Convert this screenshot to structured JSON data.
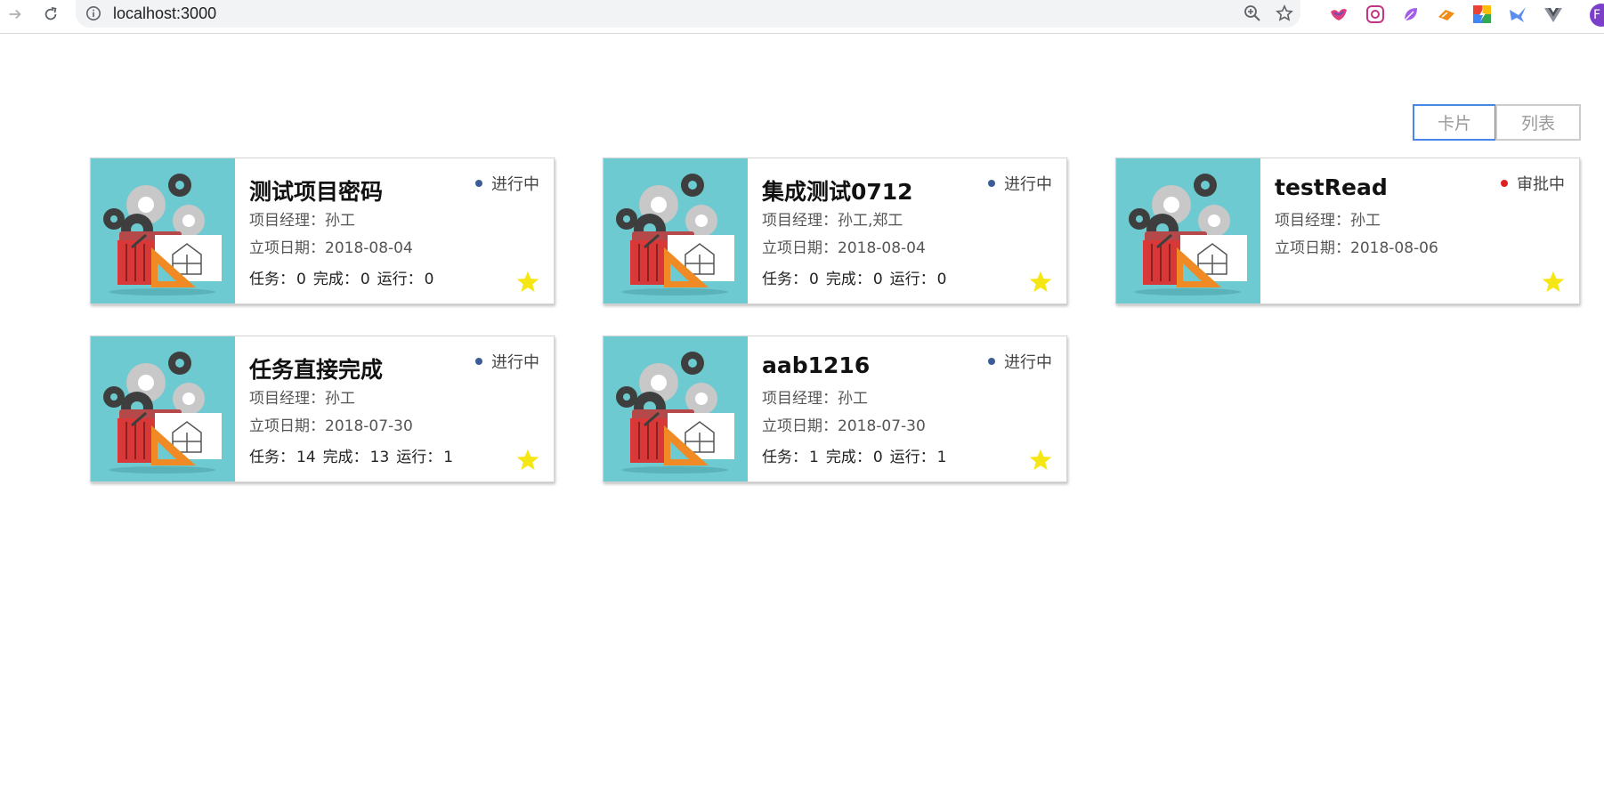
{
  "browser": {
    "url": "localhost:3000",
    "profile_initial": "F"
  },
  "view_toggle": {
    "card_label": "卡片",
    "list_label": "列表",
    "active": "card"
  },
  "labels": {
    "manager": "项目经理：",
    "date": "立项日期：",
    "tasks": "任务：",
    "done": "完成：",
    "running": "运行："
  },
  "colors": {
    "status_active": "#3b5c96",
    "status_approval": "#e02020",
    "star": "#f5e616",
    "accent": "#4a86e8",
    "thumb_bg": "#6ccad0"
  },
  "projects": [
    {
      "title": "测试项目密码",
      "manager": "孙工",
      "date": "2018-08-04",
      "status": "进行中",
      "status_color": "#3b5c96",
      "tasks": "0",
      "done": "0",
      "running": "0",
      "show_stats": true
    },
    {
      "title": "集成测试0712",
      "manager": "孙工,郑工",
      "date": "2018-08-04",
      "status": "进行中",
      "status_color": "#3b5c96",
      "tasks": "0",
      "done": "0",
      "running": "0",
      "show_stats": true
    },
    {
      "title": "testRead",
      "manager": "孙工",
      "date": "2018-08-06",
      "status": "审批中",
      "status_color": "#e02020",
      "tasks": "",
      "done": "",
      "running": "",
      "show_stats": false
    },
    {
      "title": "任务直接完成",
      "manager": "孙工",
      "date": "2018-07-30",
      "status": "进行中",
      "status_color": "#3b5c96",
      "tasks": "14",
      "done": "13",
      "running": "1",
      "show_stats": true
    },
    {
      "title": "aab1216",
      "manager": "孙工",
      "date": "2018-07-30",
      "status": "进行中",
      "status_color": "#3b5c96",
      "tasks": "1",
      "done": "0",
      "running": "1",
      "show_stats": true
    }
  ]
}
